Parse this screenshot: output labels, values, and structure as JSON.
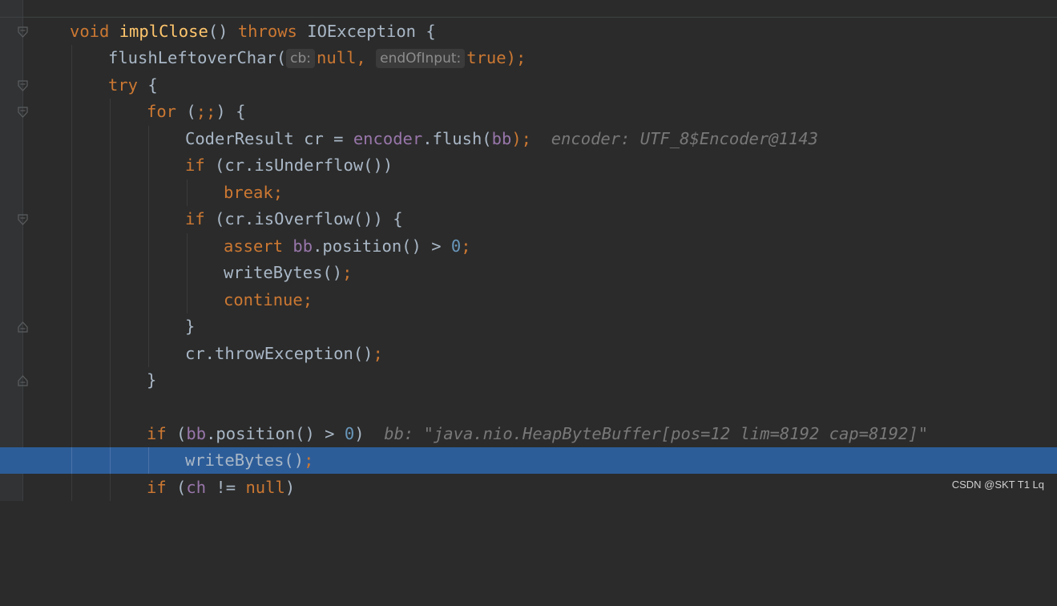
{
  "colors": {
    "background": "#2b2b2b",
    "keyword": "#cc7832",
    "method_declaration": "#ffc66d",
    "field": "#9876aa",
    "number": "#6897bb",
    "string": "#6a8759",
    "plain": "#a9b7c6",
    "current_line": "#2d5d99",
    "inline_debug_value": "#787878"
  },
  "code": {
    "l1": {
      "kw_void": "void",
      "method": "implClose",
      "parens": "()",
      "kw_throws": "throws",
      "type": "IOException",
      "brace": "{"
    },
    "l2": {
      "call": "flushLeftoverChar(",
      "hint1": "cb:",
      "arg1": "null",
      "comma": ",",
      "hint2": "endOfInput:",
      "arg2": "true",
      "end": ");"
    },
    "l3": {
      "kw_try": "try",
      "brace": "{"
    },
    "l4": {
      "kw_for": "for",
      "open": "(",
      "semis": ";;",
      "close": ") {"
    },
    "l5": {
      "decl": "CoderResult cr = ",
      "field": "encoder",
      "call": ".flush(",
      "arg": "bb",
      "end": ");",
      "debug": "encoder: UTF_8$Encoder@1143"
    },
    "l6": {
      "kw_if": "if",
      "cond": "(cr.isUnderflow())"
    },
    "l7": {
      "kw_break": "break",
      "semi": ";"
    },
    "l8": {
      "kw_if": "if",
      "cond": "(cr.isOverflow()) {"
    },
    "l9": {
      "kw_assert": "assert",
      "field": "bb",
      "call": ".position() > ",
      "num": "0",
      "semi": ";"
    },
    "l10": {
      "call": "writeBytes()",
      "semi": ";"
    },
    "l11": {
      "kw_continue": "continue",
      "semi": ";"
    },
    "l12": {
      "brace": "}"
    },
    "l13": {
      "call": "cr.throwException()",
      "semi": ";"
    },
    "l14": {
      "brace": "}"
    },
    "l16": {
      "kw_if": "if",
      "open": "(",
      "field": "bb",
      "call": ".position() > ",
      "num": "0",
      "close": ")",
      "debug": "bb: \"java.nio.HeapByteBuffer[pos=12 lim=8192 cap=8192]\""
    },
    "l17": {
      "call": "writeBytes()",
      "semi": ";"
    },
    "l18": {
      "kw_if": "if",
      "open": "(",
      "field": "ch",
      "op": " != ",
      "kw_null": "null",
      "close": ")"
    }
  },
  "watermark": "CSDN @SKT T1 Lq"
}
